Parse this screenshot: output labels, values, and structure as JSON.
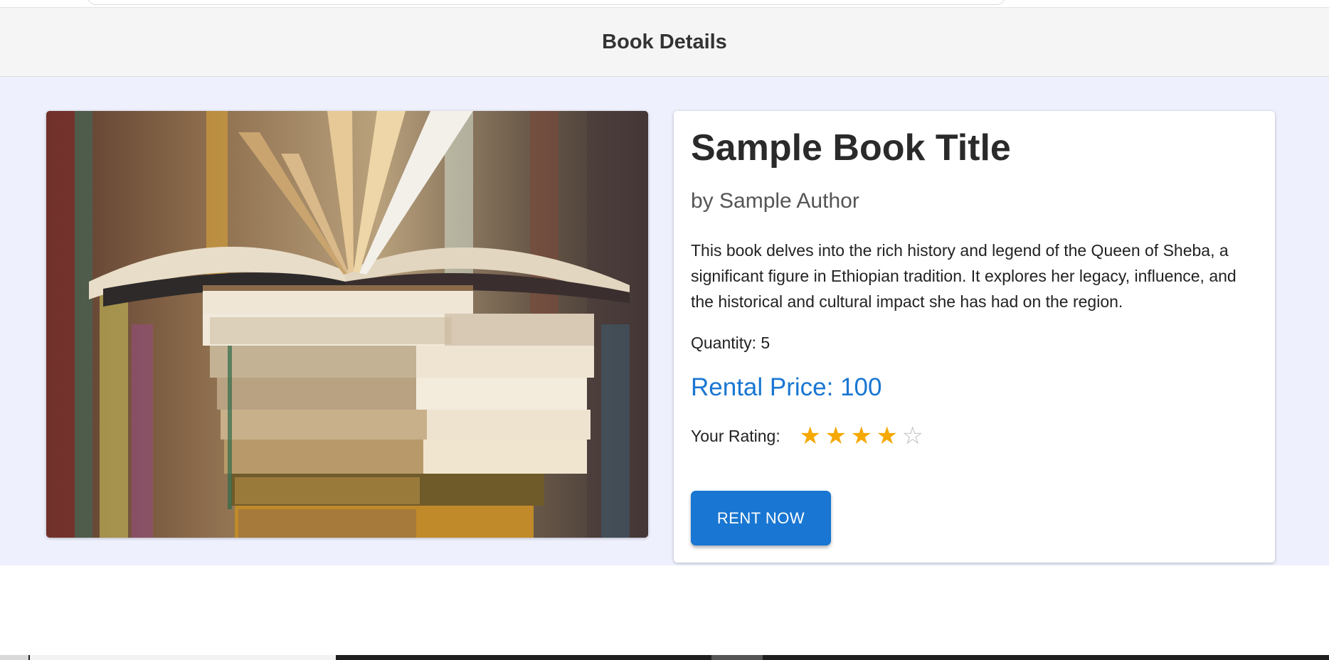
{
  "header": {
    "title": "Book Details"
  },
  "book": {
    "title": "Sample Book Title",
    "author": "by Sample Author",
    "description": "This book delves into the rich history and legend of the Queen of Sheba, a significant figure in Ethiopian tradition. It explores her legacy, influence, and the historical and cultural impact she has had on the region.",
    "quantity": "Quantity: 5",
    "rental_price": "Rental Price: 100",
    "rating_label": "Your Rating:",
    "rating": {
      "value": 4,
      "max": 5,
      "filled_glyph": "★",
      "empty_glyph": "☆"
    },
    "rent_button": "RENT NOW",
    "cover_image": "stack-of-books-with-open-book-photo"
  },
  "colors": {
    "accent": "#1976d2",
    "star": "#f5a800",
    "page_bg": "#eef0fd",
    "header_bg": "#f5f5f5"
  }
}
